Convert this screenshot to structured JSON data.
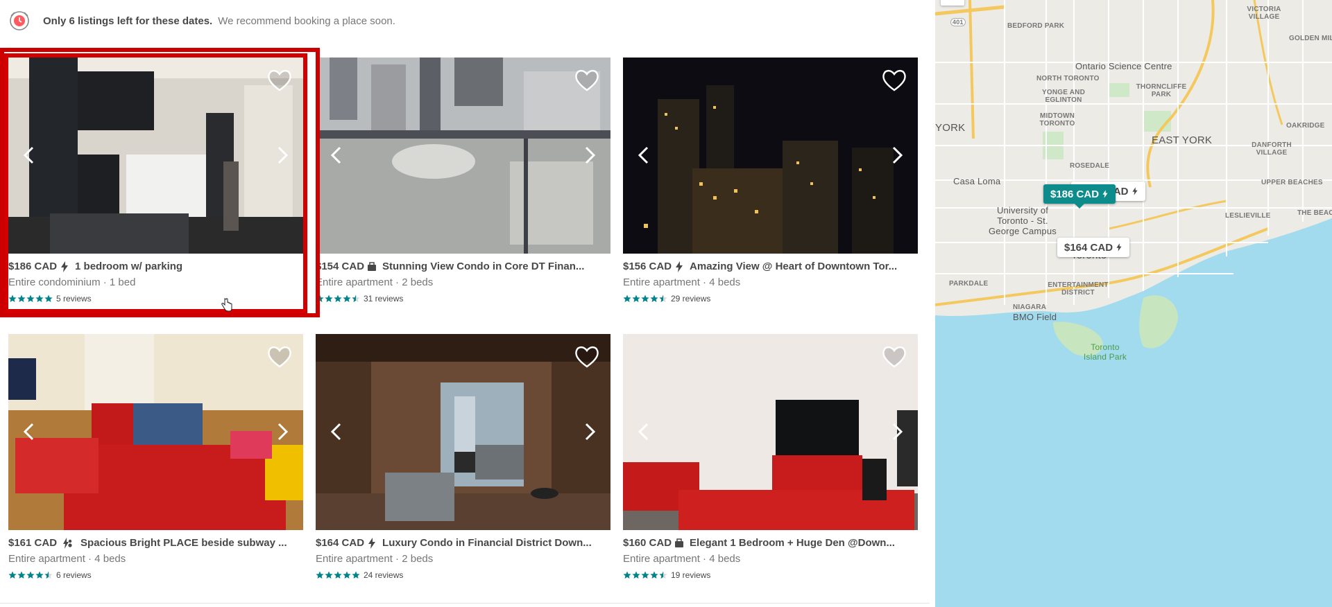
{
  "banner": {
    "strong_text": "Only 6 listings left for these dates.",
    "soft_text": "We recommend booking a place soon."
  },
  "listings": [
    {
      "price": "$186 CAD",
      "badge": "bolt-icon",
      "name": "1 bedroom w/ parking",
      "sub": "Entire condominium · 1 bed",
      "stars": 5,
      "reviews": "5 reviews",
      "selected": true
    },
    {
      "price": "$154 CAD",
      "badge": "briefcase-icon",
      "name": "Stunning View Condo in Core DT Finan...",
      "sub": "Entire apartment · 2 beds",
      "stars": 4.5,
      "reviews": "31 reviews",
      "selected": false
    },
    {
      "price": "$156 CAD",
      "badge": "bolt-icon",
      "name": "Amazing View @ Heart of Downtown Tor...",
      "sub": "Entire apartment · 4 beds",
      "stars": 4.5,
      "reviews": "29 reviews",
      "selected": false
    },
    {
      "price": "$161 CAD",
      "badge": "bolt-family-icon",
      "name": "Spacious Bright PLACE beside subway ...",
      "sub": "Entire apartment · 4 beds",
      "stars": 4.5,
      "reviews": "6 reviews",
      "selected": false
    },
    {
      "price": "$164 CAD",
      "badge": "bolt-icon",
      "name": "Luxury Condo in Financial District Down...",
      "sub": "Entire apartment · 2 beds",
      "stars": 5,
      "reviews": "24 reviews",
      "selected": false
    },
    {
      "price": "$160 CAD",
      "badge": "briefcase-icon",
      "name": "Elegant 1 Bedroom + Huge Den @Down...",
      "sub": "Entire apartment · 4 beds",
      "stars": 4.5,
      "reviews": "19 reviews",
      "selected": false
    }
  ],
  "map": {
    "zoom_out_label": "−",
    "labels": {
      "hwy401": "401",
      "bedford_park": "BEDFORD PARK",
      "victoria_village": "VICTORIA VILLAGE",
      "golden_mile": "GOLDEN MILE",
      "ontario_science_centre": "Ontario Science Centre",
      "north_toronto": "NORTH TORONTO",
      "yonge_eglinton": "YONGE AND EGLINTON",
      "thorncliffe_park": "THORNCLIFFE PARK",
      "midtown_toronto": "MIDTOWN TORONTO",
      "york": "YORK",
      "east_york": "EAST YORK",
      "oakridge": "OAKRIDGE",
      "danforth_village": "DANFORTH VILLAGE",
      "rosedale": "ROSEDALE",
      "casa_loma": "Casa Loma",
      "upper_beaches": "UPPER BEACHES",
      "university": "University of Toronto - St. George Campus",
      "leslieville": "LESLIEVILLE",
      "the_beach": "THE BEACH",
      "parkdale": "PARKDALE",
      "toronto": "Toronto",
      "entertainment_district": "ENTERTAINMENT DISTRICT",
      "niagara": "NIAGARA",
      "bmo_field": "BMO Field",
      "toronto_island_park": "Toronto Island Park"
    },
    "pins": {
      "active_price": "$186 CAD",
      "hidden_price": "CAD",
      "second_price": "$164 CAD"
    }
  },
  "colors": {
    "teal": "#008489",
    "selection_red": "#cc0000",
    "map_water": "#a3dbee",
    "pin_active": "#0e8b8b"
  }
}
